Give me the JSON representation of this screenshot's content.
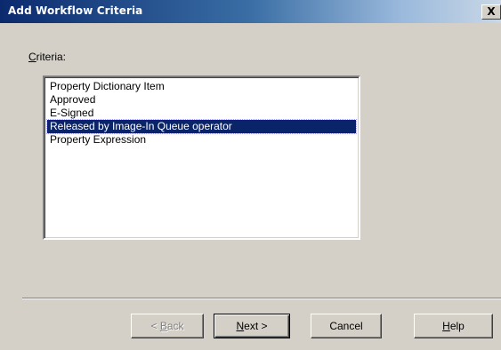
{
  "window": {
    "title": "Add Workflow Criteria",
    "close_glyph": "X"
  },
  "criteria": {
    "label_accel": "C",
    "label_rest": "riteria:",
    "items": [
      "Property Dictionary Item",
      "Approved",
      "E-Signed",
      "Released by Image-In Queue operator",
      "Property Expression"
    ],
    "selected_index": 3
  },
  "buttons": {
    "back_prefix": "< ",
    "back_accel": "B",
    "back_rest": "ack",
    "next_accel": "N",
    "next_rest": "ext >",
    "cancel": "Cancel",
    "help_accel": "H",
    "help_rest": "elp"
  },
  "colors": {
    "dialog_bg": "#d4d0c8",
    "title_bar_dark": "#0b2a6e",
    "selection_bg": "#0a246a",
    "selection_text": "#ffffff"
  }
}
